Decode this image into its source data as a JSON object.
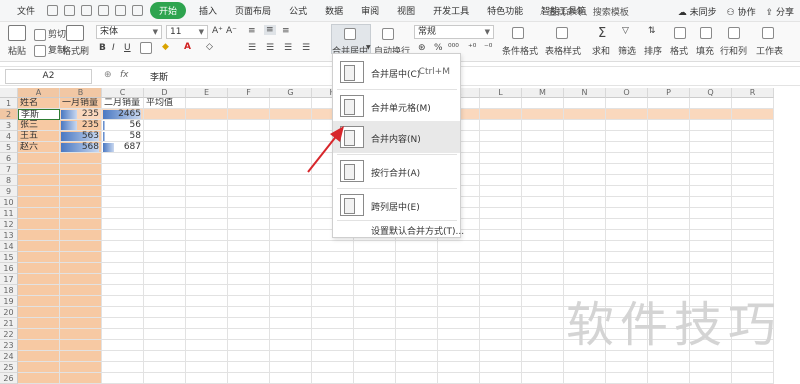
{
  "menubar": {
    "file": "文件",
    "tabs": [
      "开始",
      "插入",
      "页面布局",
      "公式",
      "数据",
      "审阅",
      "视图",
      "开发工具",
      "特色功能",
      "智能工具箱"
    ],
    "search": "查找命令、搜索模板",
    "sync": "未同步",
    "collab": "协作",
    "share": "分享"
  },
  "ribbon": {
    "paste": "粘贴",
    "cut": "剪切",
    "copy": "复制",
    "format_painter": "格式刷",
    "font": "宋体",
    "font_size": "11",
    "bold": "B",
    "italic": "I",
    "underline": "U",
    "merge_center": "合并居中",
    "wrap": "自动换行",
    "number_format": "常规",
    "percent": "%",
    "cond_format": "条件格式",
    "table_style": "表格样式",
    "sum": "求和",
    "filter": "筛选",
    "sort": "排序",
    "format": "格式",
    "fill": "填充",
    "row_col": "行和列",
    "worksheet": "工作表"
  },
  "formula_bar": {
    "name_box": "A2",
    "fx": "fx",
    "value": "李斯"
  },
  "columns": [
    "A",
    "B",
    "C",
    "D",
    "E",
    "F",
    "G",
    "H",
    "I",
    "J",
    "K",
    "L",
    "M",
    "N",
    "O",
    "P",
    "Q",
    "R"
  ],
  "rows": [
    "1",
    "2",
    "3",
    "4",
    "5",
    "6",
    "7",
    "8",
    "9",
    "10",
    "11",
    "12",
    "13",
    "14",
    "15",
    "16",
    "17",
    "18",
    "19",
    "20",
    "21",
    "22",
    "23",
    "24",
    "25",
    "26"
  ],
  "table": {
    "headers": [
      "姓名",
      "一月销量",
      "二月销量",
      "平均值"
    ],
    "data": [
      {
        "name": "李斯",
        "jan": "235",
        "feb": "2465"
      },
      {
        "name": "张三",
        "jan": "235",
        "feb": "56"
      },
      {
        "name": "王五",
        "jan": "563",
        "feb": "58"
      },
      {
        "name": "赵六",
        "jan": "568",
        "feb": "687"
      }
    ]
  },
  "merge_menu": {
    "items": [
      {
        "label": "合并居中(C)",
        "shortcut": "Ctrl+M"
      },
      {
        "label": "合并单元格(M)",
        "shortcut": ""
      },
      {
        "label": "合并内容(N)",
        "shortcut": ""
      },
      {
        "label": "按行合并(A)",
        "shortcut": ""
      },
      {
        "label": "跨列居中(E)",
        "shortcut": ""
      }
    ],
    "footer": "设置默认合并方式(T)..."
  },
  "watermark": "软件技巧",
  "colors": {
    "highlight_col": "#f7c9a3",
    "highlight_row": "#fad8bd",
    "start_tab": "#2ea44f",
    "databar": "#4a78c2",
    "arrow": "#d7262b"
  }
}
